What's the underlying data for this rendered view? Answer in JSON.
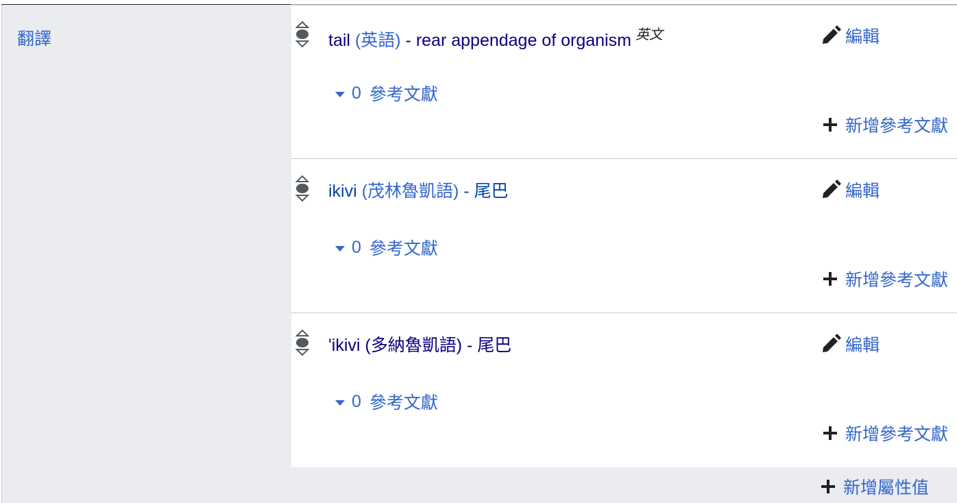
{
  "property": {
    "label": "翻譯"
  },
  "statements": [
    {
      "lemma": "tail",
      "language": "英語",
      "gloss": "rear appendage of organism",
      "gloss_language": "英文",
      "edit_label": "編輯",
      "ref_count": "0",
      "refs_label": "參考文獻",
      "add_ref_label": "新增參考文獻"
    },
    {
      "lemma": "ikivi",
      "language": "茂林魯凱語",
      "gloss": "尾巴",
      "edit_label": "編輯",
      "ref_count": "0",
      "refs_label": "參考文獻",
      "add_ref_label": "新增參考文獻"
    },
    {
      "lemma": "'ikivi",
      "language": "多納魯凱語",
      "gloss": "尾巴",
      "edit_label": "編輯",
      "ref_count": "0",
      "refs_label": "參考文獻",
      "add_ref_label": "新增參考文獻"
    }
  ],
  "add_value_label": "新增屬性值",
  "icons": {
    "rank": "rank-normal-icon",
    "edit": "pencil-icon",
    "add": "plus-icon",
    "toggle": "caret-down-icon"
  },
  "colors": {
    "link": "#3366cc",
    "visited_link": "#0b0080",
    "label_background": "#eaecf0",
    "border": "#c8ccd1",
    "text": "#202122"
  }
}
